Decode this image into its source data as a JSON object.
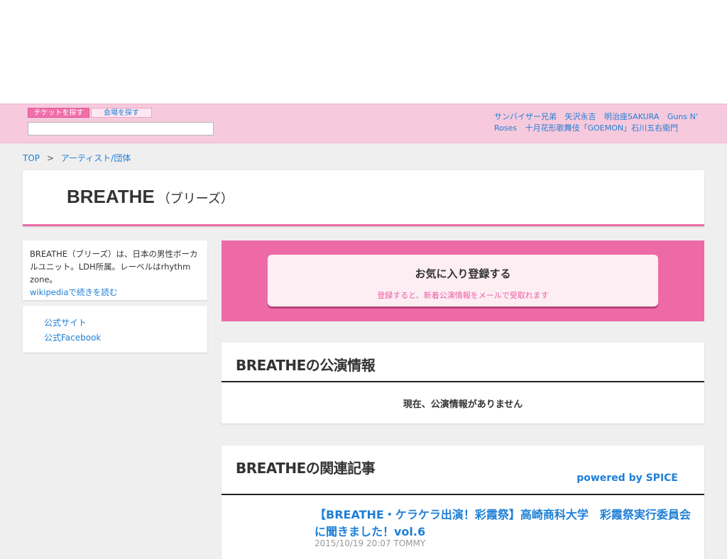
{
  "header": {
    "tab_ticket": "チケットを探す",
    "tab_venue": "会場を探す",
    "search_placeholder": "",
    "hot_links": [
      "サンバイザー兄弟",
      "矢沢永吉",
      "明治座SAKURA",
      "Guns N' Roses",
      "十月花形歌舞伎「GOEMON」石川五右衛門"
    ]
  },
  "breadcrumb": {
    "top": "TOP",
    "separator": ">",
    "current": "アーティスト/団体"
  },
  "artist": {
    "name": "BREATHE",
    "reading": "（ブリーズ）"
  },
  "sidebar": {
    "description": "BREATHE（ブリーズ）は、日本の男性ボーカルユニット。LDH所属。レーベルはrhythm zone。",
    "wiki_link": "wikipediaで続きを読む",
    "links": [
      "公式サイト",
      "公式Facebook"
    ]
  },
  "favorite": {
    "button_label": "お気に入り登録する",
    "button_sub": "登録すると、新着公演情報をメールで受取れます"
  },
  "performances": {
    "title": "BREATHEの公演情報",
    "empty_message": "現在、公演情報がありません"
  },
  "articles": {
    "title": "BREATHEの関連記事",
    "powered_by": "powered by SPICE",
    "items": [
      {
        "title": "【BREATHE・ケラケラ出演！彩霞祭】高崎商科大学　彩霞祭実行委員会に聞きました！vol.6",
        "meta": "2015/10/19 20:07 TOMMY"
      }
    ]
  },
  "colors": {
    "accent_pink": "#ee6aa6",
    "link_blue": "#1e7fd6",
    "header_pink": "#f7c9dd"
  }
}
